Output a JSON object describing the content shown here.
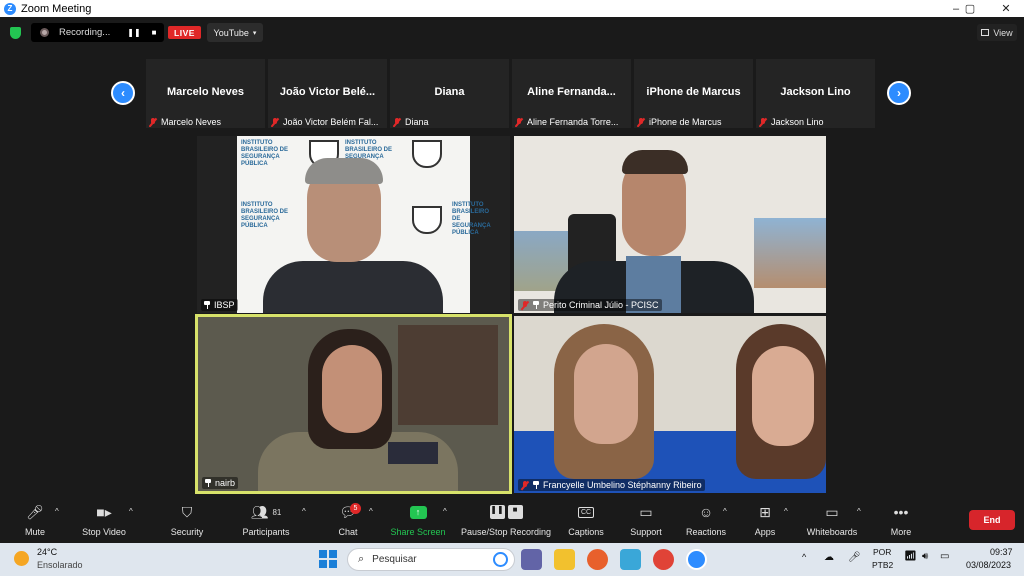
{
  "window": {
    "title": "Zoom Meeting",
    "controls": [
      "–",
      "▢",
      "✕"
    ]
  },
  "recording": {
    "status": "Recording...",
    "live_label": "LIVE",
    "stream_target": "YouTube",
    "stream_caret": "▾"
  },
  "view_button": "View",
  "participants_strip": [
    {
      "name": "Marcelo Neves",
      "label": "Marcelo Neves"
    },
    {
      "name": "João Victor Belé...",
      "label": "João Victor Belém Fal..."
    },
    {
      "name": "Diana",
      "label": "Diana"
    },
    {
      "name": "Aline  Fernanda...",
      "label": "Aline Fernanda Torre..."
    },
    {
      "name": "iPhone de Marcus",
      "label": "iPhone de Marcus"
    },
    {
      "name": "Jackson Lino",
      "label": "Jackson Lino"
    }
  ],
  "nav": {
    "prev": "‹",
    "next": "›"
  },
  "video_tiles": [
    {
      "label": "IBSP",
      "mic_muted": false,
      "backdrop_text": [
        "INSTITUTO",
        "BRASILEIRO DE",
        "SEGURANÇA",
        "PÚBLICA"
      ]
    },
    {
      "label": "Perito Criminal Júlio - PCISC",
      "mic_muted": true
    },
    {
      "label": "nairb",
      "mic_muted": false,
      "active_speaker": true
    },
    {
      "label": "Francyelle Umbelino Stéphanny Ribeiro",
      "mic_muted": true
    }
  ],
  "toolbar": {
    "mute": "Mute",
    "stop_video": "Stop Video",
    "security": "Security",
    "participants": "Participants",
    "participants_count": "81",
    "chat": "Chat",
    "chat_badge": "5",
    "share_screen": "Share Screen",
    "pause_recording": "Pause/Stop Recording",
    "captions": "Captions",
    "captions_icon_text": "CC",
    "support": "Support",
    "reactions": "Reactions",
    "apps": "Apps",
    "whiteboards": "Whiteboards",
    "more": "More",
    "end": "End"
  },
  "taskbar": {
    "weather_temp": "24°C",
    "weather_desc": "Ensolarado",
    "search_placeholder": "Pesquisar",
    "lang_top": "POR",
    "lang_bottom": "PTB2",
    "time": "09:37",
    "date": "03/08/2023"
  },
  "colors": {
    "accent": "#2d8cff",
    "live": "#e02828",
    "share": "#23c552",
    "end": "#d7252b",
    "speaker_border": "#d7e26a"
  }
}
